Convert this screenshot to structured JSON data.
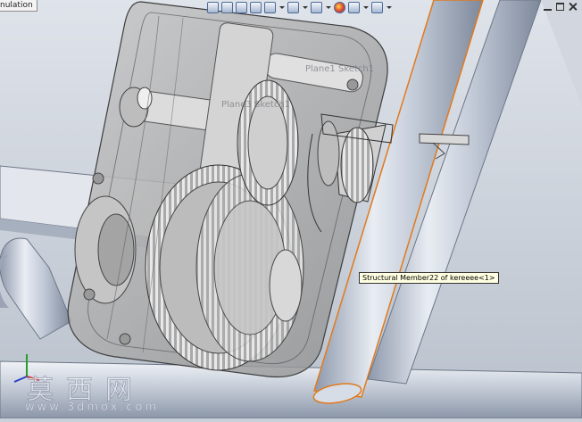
{
  "tab": {
    "label": "nulation"
  },
  "tooltip": {
    "text": "Structural Member22 of kereeee<1>"
  },
  "plane_labels": {
    "a": "Plane1 Sketch1",
    "b": "Plane3 Sketch1"
  },
  "watermark": {
    "title": "莫西网",
    "url": "www.3dmox.com"
  },
  "toolbar_icons": [
    "zoom-to-fit-icon",
    "zoom-area-icon",
    "previous-view-icon",
    "section-view-icon",
    "view-orientation-icon",
    "display-style-icon",
    "hide-show-icon",
    "edit-appearance-icon",
    "apply-scene-icon",
    "view-settings-icon"
  ],
  "colors": {
    "viewport": "#c9d0da",
    "selection": "#e07a1e",
    "tooltip_bg": "#ffffe1"
  }
}
